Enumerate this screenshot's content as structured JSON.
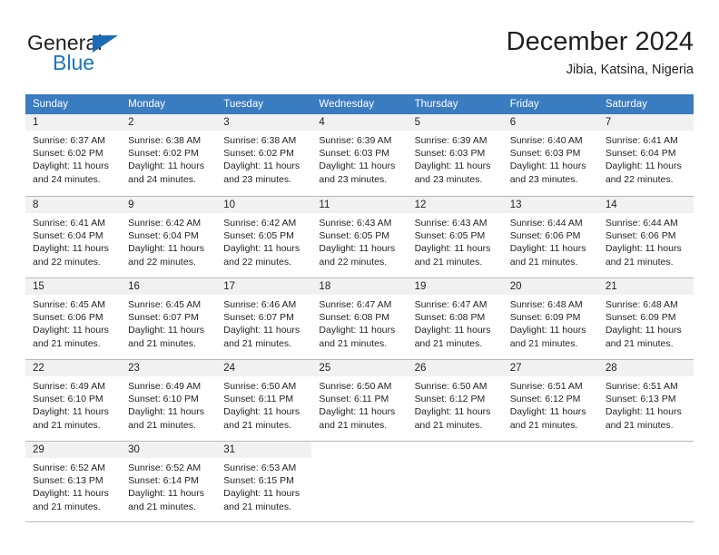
{
  "brand": {
    "name_part1": "General",
    "name_part2": "Blue",
    "triangle_color": "#1b6cb3",
    "blue_color": "#1b75bc"
  },
  "header": {
    "title": "December 2024",
    "subtitle": "Jibia, Katsina, Nigeria"
  },
  "calendar": {
    "header_bg": "#3a7cc0",
    "day_head_bg": "#f1f1f1",
    "border_color": "#b9b9b9",
    "weekdays": [
      "Sunday",
      "Monday",
      "Tuesday",
      "Wednesday",
      "Thursday",
      "Friday",
      "Saturday"
    ],
    "weeks": [
      [
        {
          "date": "1",
          "sunrise": "Sunrise: 6:37 AM",
          "sunset": "Sunset: 6:02 PM",
          "daylight_line1": "Daylight: 11 hours",
          "daylight_line2": "and 24 minutes."
        },
        {
          "date": "2",
          "sunrise": "Sunrise: 6:38 AM",
          "sunset": "Sunset: 6:02 PM",
          "daylight_line1": "Daylight: 11 hours",
          "daylight_line2": "and 24 minutes."
        },
        {
          "date": "3",
          "sunrise": "Sunrise: 6:38 AM",
          "sunset": "Sunset: 6:02 PM",
          "daylight_line1": "Daylight: 11 hours",
          "daylight_line2": "and 23 minutes."
        },
        {
          "date": "4",
          "sunrise": "Sunrise: 6:39 AM",
          "sunset": "Sunset: 6:03 PM",
          "daylight_line1": "Daylight: 11 hours",
          "daylight_line2": "and 23 minutes."
        },
        {
          "date": "5",
          "sunrise": "Sunrise: 6:39 AM",
          "sunset": "Sunset: 6:03 PM",
          "daylight_line1": "Daylight: 11 hours",
          "daylight_line2": "and 23 minutes."
        },
        {
          "date": "6",
          "sunrise": "Sunrise: 6:40 AM",
          "sunset": "Sunset: 6:03 PM",
          "daylight_line1": "Daylight: 11 hours",
          "daylight_line2": "and 23 minutes."
        },
        {
          "date": "7",
          "sunrise": "Sunrise: 6:41 AM",
          "sunset": "Sunset: 6:04 PM",
          "daylight_line1": "Daylight: 11 hours",
          "daylight_line2": "and 22 minutes."
        }
      ],
      [
        {
          "date": "8",
          "sunrise": "Sunrise: 6:41 AM",
          "sunset": "Sunset: 6:04 PM",
          "daylight_line1": "Daylight: 11 hours",
          "daylight_line2": "and 22 minutes."
        },
        {
          "date": "9",
          "sunrise": "Sunrise: 6:42 AM",
          "sunset": "Sunset: 6:04 PM",
          "daylight_line1": "Daylight: 11 hours",
          "daylight_line2": "and 22 minutes."
        },
        {
          "date": "10",
          "sunrise": "Sunrise: 6:42 AM",
          "sunset": "Sunset: 6:05 PM",
          "daylight_line1": "Daylight: 11 hours",
          "daylight_line2": "and 22 minutes."
        },
        {
          "date": "11",
          "sunrise": "Sunrise: 6:43 AM",
          "sunset": "Sunset: 6:05 PM",
          "daylight_line1": "Daylight: 11 hours",
          "daylight_line2": "and 22 minutes."
        },
        {
          "date": "12",
          "sunrise": "Sunrise: 6:43 AM",
          "sunset": "Sunset: 6:05 PM",
          "daylight_line1": "Daylight: 11 hours",
          "daylight_line2": "and 21 minutes."
        },
        {
          "date": "13",
          "sunrise": "Sunrise: 6:44 AM",
          "sunset": "Sunset: 6:06 PM",
          "daylight_line1": "Daylight: 11 hours",
          "daylight_line2": "and 21 minutes."
        },
        {
          "date": "14",
          "sunrise": "Sunrise: 6:44 AM",
          "sunset": "Sunset: 6:06 PM",
          "daylight_line1": "Daylight: 11 hours",
          "daylight_line2": "and 21 minutes."
        }
      ],
      [
        {
          "date": "15",
          "sunrise": "Sunrise: 6:45 AM",
          "sunset": "Sunset: 6:06 PM",
          "daylight_line1": "Daylight: 11 hours",
          "daylight_line2": "and 21 minutes."
        },
        {
          "date": "16",
          "sunrise": "Sunrise: 6:45 AM",
          "sunset": "Sunset: 6:07 PM",
          "daylight_line1": "Daylight: 11 hours",
          "daylight_line2": "and 21 minutes."
        },
        {
          "date": "17",
          "sunrise": "Sunrise: 6:46 AM",
          "sunset": "Sunset: 6:07 PM",
          "daylight_line1": "Daylight: 11 hours",
          "daylight_line2": "and 21 minutes."
        },
        {
          "date": "18",
          "sunrise": "Sunrise: 6:47 AM",
          "sunset": "Sunset: 6:08 PM",
          "daylight_line1": "Daylight: 11 hours",
          "daylight_line2": "and 21 minutes."
        },
        {
          "date": "19",
          "sunrise": "Sunrise: 6:47 AM",
          "sunset": "Sunset: 6:08 PM",
          "daylight_line1": "Daylight: 11 hours",
          "daylight_line2": "and 21 minutes."
        },
        {
          "date": "20",
          "sunrise": "Sunrise: 6:48 AM",
          "sunset": "Sunset: 6:09 PM",
          "daylight_line1": "Daylight: 11 hours",
          "daylight_line2": "and 21 minutes."
        },
        {
          "date": "21",
          "sunrise": "Sunrise: 6:48 AM",
          "sunset": "Sunset: 6:09 PM",
          "daylight_line1": "Daylight: 11 hours",
          "daylight_line2": "and 21 minutes."
        }
      ],
      [
        {
          "date": "22",
          "sunrise": "Sunrise: 6:49 AM",
          "sunset": "Sunset: 6:10 PM",
          "daylight_line1": "Daylight: 11 hours",
          "daylight_line2": "and 21 minutes."
        },
        {
          "date": "23",
          "sunrise": "Sunrise: 6:49 AM",
          "sunset": "Sunset: 6:10 PM",
          "daylight_line1": "Daylight: 11 hours",
          "daylight_line2": "and 21 minutes."
        },
        {
          "date": "24",
          "sunrise": "Sunrise: 6:50 AM",
          "sunset": "Sunset: 6:11 PM",
          "daylight_line1": "Daylight: 11 hours",
          "daylight_line2": "and 21 minutes."
        },
        {
          "date": "25",
          "sunrise": "Sunrise: 6:50 AM",
          "sunset": "Sunset: 6:11 PM",
          "daylight_line1": "Daylight: 11 hours",
          "daylight_line2": "and 21 minutes."
        },
        {
          "date": "26",
          "sunrise": "Sunrise: 6:50 AM",
          "sunset": "Sunset: 6:12 PM",
          "daylight_line1": "Daylight: 11 hours",
          "daylight_line2": "and 21 minutes."
        },
        {
          "date": "27",
          "sunrise": "Sunrise: 6:51 AM",
          "sunset": "Sunset: 6:12 PM",
          "daylight_line1": "Daylight: 11 hours",
          "daylight_line2": "and 21 minutes."
        },
        {
          "date": "28",
          "sunrise": "Sunrise: 6:51 AM",
          "sunset": "Sunset: 6:13 PM",
          "daylight_line1": "Daylight: 11 hours",
          "daylight_line2": "and 21 minutes."
        }
      ],
      [
        {
          "date": "29",
          "sunrise": "Sunrise: 6:52 AM",
          "sunset": "Sunset: 6:13 PM",
          "daylight_line1": "Daylight: 11 hours",
          "daylight_line2": "and 21 minutes."
        },
        {
          "date": "30",
          "sunrise": "Sunrise: 6:52 AM",
          "sunset": "Sunset: 6:14 PM",
          "daylight_line1": "Daylight: 11 hours",
          "daylight_line2": "and 21 minutes."
        },
        {
          "date": "31",
          "sunrise": "Sunrise: 6:53 AM",
          "sunset": "Sunset: 6:15 PM",
          "daylight_line1": "Daylight: 11 hours",
          "daylight_line2": "and 21 minutes."
        },
        {
          "date": "",
          "sunrise": "",
          "sunset": "",
          "daylight_line1": "",
          "daylight_line2": ""
        },
        {
          "date": "",
          "sunrise": "",
          "sunset": "",
          "daylight_line1": "",
          "daylight_line2": ""
        },
        {
          "date": "",
          "sunrise": "",
          "sunset": "",
          "daylight_line1": "",
          "daylight_line2": ""
        },
        {
          "date": "",
          "sunrise": "",
          "sunset": "",
          "daylight_line1": "",
          "daylight_line2": ""
        }
      ]
    ]
  }
}
